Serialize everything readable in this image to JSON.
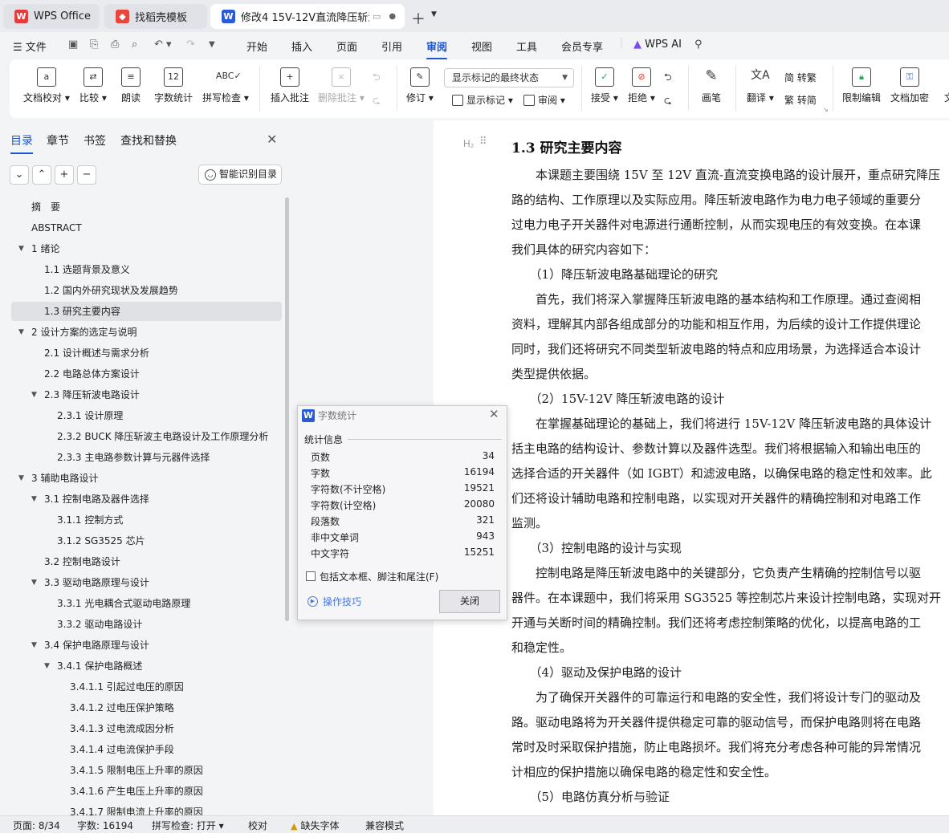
{
  "tabs": {
    "wps_office": "WPS Office",
    "templates": "找稻壳模板",
    "document": "修改4 15V-12V直流降压斩波电"
  },
  "menu": {
    "file": "文件",
    "items": [
      "开始",
      "插入",
      "页面",
      "引用",
      "审阅",
      "视图",
      "工具",
      "会员专享"
    ],
    "active": "审阅",
    "wps_ai": "WPS AI"
  },
  "ribbon": {
    "doc_proof": "文档校对",
    "compare": "比较",
    "read_aloud": "朗读",
    "word_count": "字数统计",
    "spell_check": "拼写检查",
    "insert_comment": "插入批注",
    "delete_comment": "删除批注",
    "revise": "修订",
    "markup_mode": "显示标记的最终状态",
    "show_markup": "显示标记",
    "review": "审阅",
    "accept": "接受",
    "reject": "拒绝",
    "pen": "画笔",
    "translate": "翻译",
    "to_traditional": "简 转繁",
    "to_simplified": "繁 转简",
    "restrict_edit": "限制编辑",
    "doc_encrypt": "文档加密",
    "more": "文"
  },
  "panel": {
    "tabs": [
      "目录",
      "章节",
      "书签",
      "查找和替换"
    ],
    "active_tab": "目录",
    "smart_toc": "智能识别目录",
    "toc": [
      {
        "label": "摘　要",
        "level": 1,
        "toggle": ""
      },
      {
        "label": "ABSTRACT",
        "level": 1,
        "toggle": ""
      },
      {
        "label": "1  绪论",
        "level": 1,
        "toggle": "▼"
      },
      {
        "label": "1.1  选题背景及意义",
        "level": 2,
        "toggle": ""
      },
      {
        "label": "1.2  国内外研究现状及发展趋势",
        "level": 2,
        "toggle": ""
      },
      {
        "label": "1.3  研究主要内容",
        "level": 2,
        "toggle": "",
        "selected": true
      },
      {
        "label": "2  设计方案的选定与说明",
        "level": 1,
        "toggle": "▼"
      },
      {
        "label": "2.1 设计概述与需求分析",
        "level": 2,
        "toggle": ""
      },
      {
        "label": "2.2 电路总体方案设计",
        "level": 2,
        "toggle": ""
      },
      {
        "label": "2.3  降压斩波电路设计",
        "level": 2,
        "toggle": "▼"
      },
      {
        "label": "2.3.1  设计原理",
        "level": 3,
        "toggle": ""
      },
      {
        "label": "2.3.2 BUCK 降压斩波主电路设计及工作原理分析",
        "level": 3,
        "toggle": ""
      },
      {
        "label": "2.3.3  主电路参数计算与元器件选择",
        "level": 3,
        "toggle": ""
      },
      {
        "label": "3  辅助电路设计",
        "level": 1,
        "toggle": "▼"
      },
      {
        "label": "3.1 控制电路及器件选择",
        "level": 2,
        "toggle": "▼"
      },
      {
        "label": "3.1.1  控制方式",
        "level": 3,
        "toggle": ""
      },
      {
        "label": "3.1.2 SG3525 芯片",
        "level": 3,
        "toggle": ""
      },
      {
        "label": "3.2 控制电路设计",
        "level": 2,
        "toggle": ""
      },
      {
        "label": "3.3  驱动电路原理与设计",
        "level": 2,
        "toggle": "▼"
      },
      {
        "label": "3.3.1  光电耦合式驱动电路原理",
        "level": 3,
        "toggle": ""
      },
      {
        "label": "3.3.2  驱动电路设计",
        "level": 3,
        "toggle": ""
      },
      {
        "label": "3.4 保护电路原理与设计",
        "level": 2,
        "toggle": "▼"
      },
      {
        "label": "3.4.1 保护电路概述",
        "level": 3,
        "toggle": "▼"
      },
      {
        "label": "3.4.1.1  引起过电压的原因",
        "level": 4,
        "toggle": ""
      },
      {
        "label": "3.4.1.2  过电压保护策略",
        "level": 4,
        "toggle": ""
      },
      {
        "label": "3.4.1.3  过电流成因分析",
        "level": 4,
        "toggle": ""
      },
      {
        "label": "3.4.1.4  过电流保护手段",
        "level": 4,
        "toggle": ""
      },
      {
        "label": "3.4.1.5  限制电压上升率的原因",
        "level": 4,
        "toggle": ""
      },
      {
        "label": "3.4.1.6  产生电压上升率的原因",
        "level": 4,
        "toggle": ""
      },
      {
        "label": "3.4.1.7  限制电流上升率的原因",
        "level": 4,
        "toggle": ""
      }
    ]
  },
  "document": {
    "heading_style": "H₂",
    "heading": "1.3  研究主要内容",
    "lines": [
      "　　本课题主要围绕 15V 至 12V 直流-直流变换电路的设计展开，重点研究降压",
      "路的结构、工作原理以及实际应用。降压斩波电路作为电力电子领域的重要分",
      "过电力电子开关器件对电源进行通断控制，从而实现电压的有效变换。在本课",
      "我们具体的研究内容如下：",
      "　　（1）降压斩波电路基础理论的研究",
      "　　首先，我们将深入掌握降压斩波电路的基本结构和工作原理。通过查阅相",
      "资料，理解其内部各组成部分的功能和相互作用，为后续的设计工作提供理论",
      "同时，我们还将研究不同类型斩波电路的特点和应用场景，为选择适合本设计",
      "类型提供依据。",
      "　　（2）15V-12V 降压斩波电路的设计",
      "　　在掌握基础理论的基础上，我们将进行 15V-12V 降压斩波电路的具体设计",
      "括主电路的结构设计、参数计算以及器件选型。我们将根据输入和输出电压的",
      "选择合适的开关器件（如 IGBT）和滤波电路，以确保电路的稳定性和效率。此",
      "们还将设计辅助电路和控制电路，以实现对开关器件的精确控制和对电路工作",
      "监测。",
      "　　（3）控制电路的设计与实现",
      "　　控制电路是降压斩波电路中的关键部分，它负责产生精确的控制信号以驱",
      "器件。在本课题中，我们将采用 SG3525 等控制芯片来设计控制电路，实现对开",
      "开通与关断时间的精确控制。我们还将考虑控制策略的优化，以提高电路的工",
      "和稳定性。",
      "　　（4）驱动及保护电路的设计",
      "　　为了确保开关器件的可靠运行和电路的安全性，我们将设计专门的驱动及",
      "路。驱动电路将为开关器件提供稳定可靠的驱动信号，而保护电路则将在电路",
      "常时及时采取保护措施，防止电路损坏。我们将充分考虑各种可能的异常情况",
      "计相应的保护措施以确保电路的稳定性和安全性。",
      "　　（5）电路仿真分析与验证"
    ]
  },
  "dialog": {
    "title": "字数统计",
    "section": "统计信息",
    "stats": [
      {
        "label": "页数",
        "value": "34"
      },
      {
        "label": "字数",
        "value": "16194"
      },
      {
        "label": "字符数(不计空格)",
        "value": "19521"
      },
      {
        "label": "字符数(计空格)",
        "value": "20080"
      },
      {
        "label": "段落数",
        "value": "321"
      },
      {
        "label": "非中文单词",
        "value": "943"
      },
      {
        "label": "中文字符",
        "value": "15251"
      }
    ],
    "include_label": "包括文本框、脚注和尾注(F)",
    "tips": "操作技巧",
    "close": "关闭"
  },
  "status": {
    "page": "页面: 8/34",
    "words": "字数: 16194",
    "spell": "拼写检查: 打开",
    "proof": "校对",
    "missing_font": "缺失字体",
    "compat": "兼容模式"
  },
  "colors": {
    "accent": "#1a56d6",
    "wps_red": "#e23c3c"
  }
}
